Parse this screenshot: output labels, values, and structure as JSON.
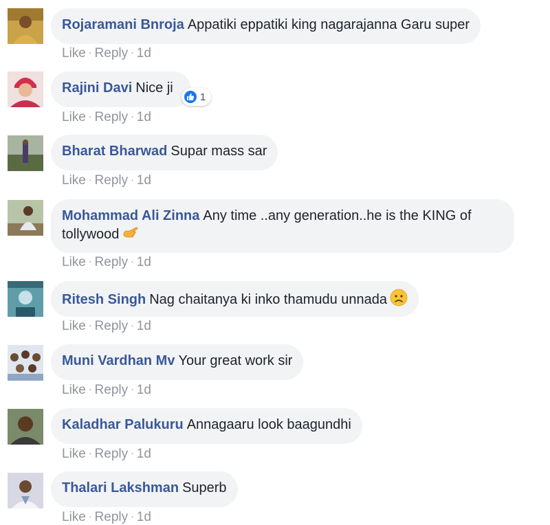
{
  "comments": [
    {
      "author": "Rojaramani Bnroja",
      "text": "Appatiki eppatiki king nagarajanna Garu super",
      "like": "Like",
      "reply": "Reply",
      "time": "1d",
      "avatar_color": "#c9a24a"
    },
    {
      "author": "Rajini Davi",
      "text": "Nice ji",
      "like": "Like",
      "reply": "Reply",
      "time": "1d",
      "reaction_count": "1",
      "avatar_color": "#e8c2c2"
    },
    {
      "author": "Bharat Bharwad",
      "text": "Supar mass sar",
      "like": "Like",
      "reply": "Reply",
      "time": "1d",
      "avatar_color": "#6b7a56"
    },
    {
      "author": "Mohammad Ali Zinna",
      "text": "Any time ..any generation..he is the KING of tollywood",
      "like": "Like",
      "reply": "Reply",
      "time": "1d",
      "avatar_color": "#9aa58a"
    },
    {
      "author": "Ritesh Singh",
      "text": "Nag chaitanya ki inko thamudu unnada",
      "like": "Like",
      "reply": "Reply",
      "time": "1d",
      "avatar_color": "#5f9ea8"
    },
    {
      "author": "Muni Vardhan Mv",
      "text": "Your great work sir",
      "like": "Like",
      "reply": "Reply",
      "time": "1d",
      "avatar_color": "#8fa6c4"
    },
    {
      "author": "Kaladhar Palukuru",
      "text": "Annagaaru look baagundhi",
      "like": "Like",
      "reply": "Reply",
      "time": "1d",
      "avatar_color": "#7a6a55"
    },
    {
      "author": "Thalari Lakshman",
      "text": "Superb",
      "like": "Like",
      "reply": "Reply",
      "time": "1d",
      "avatar_color": "#b8b8c8"
    }
  ],
  "colors": {
    "author": "#385898",
    "text": "#1d2129",
    "meta": "#90949c",
    "bubble": "#f2f3f5",
    "like_reaction": "#1877f2"
  },
  "icons": {
    "reaction": "thumbs-up-icon",
    "emoji_point": "pointing-hand-emoji",
    "emoji_sad": "slightly-frowning-face-emoji"
  }
}
